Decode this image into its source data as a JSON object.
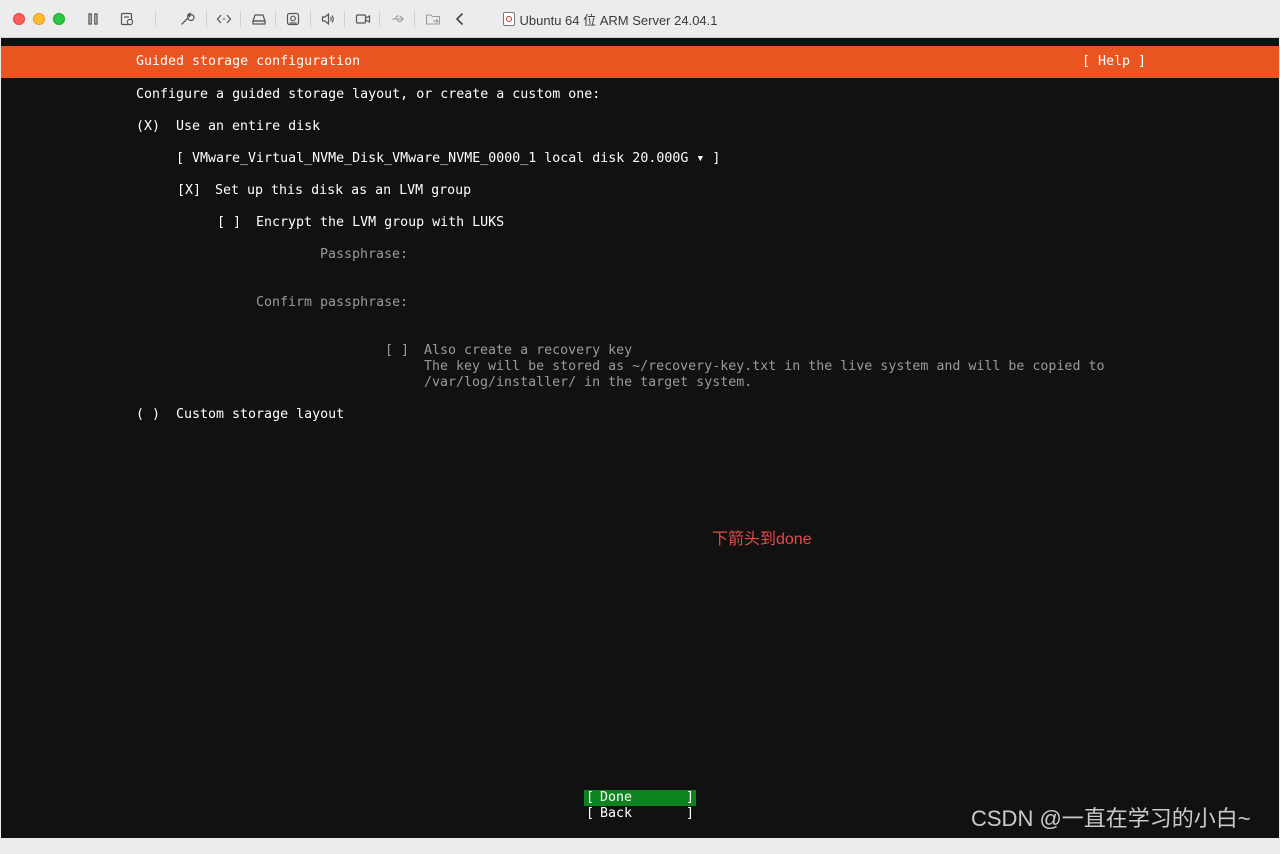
{
  "window": {
    "title": "Ubuntu 64 位 ARM Server 24.04.1",
    "toolbar_icons": [
      "pause-icon",
      "snapshot-icon",
      "wrench-icon",
      "code-icon",
      "disk-icon",
      "camera-icon",
      "sound-icon",
      "video-icon",
      "usb-icon",
      "folder-icon",
      "chevron-left-icon"
    ]
  },
  "installer": {
    "header_title": "Guided storage configuration",
    "help_label": "[ Help ]",
    "intro": "Configure a guided storage layout, or create a custom one:",
    "entire_disk_radio": "(X)",
    "entire_disk_label": "Use an entire disk",
    "disk_select": "[ VMware_Virtual_NVMe_Disk_VMware_NVME_0000_1 local disk 20.000G ▾ ]",
    "lvm_checkbox": "[X]",
    "lvm_label": "Set up this disk as an LVM group",
    "encrypt_checkbox": "[ ]",
    "encrypt_label": "Encrypt the LVM group with LUKS",
    "passphrase_label": "Passphrase:",
    "confirm_label": "Confirm passphrase:",
    "recovery_checkbox": "[ ]",
    "recovery_label": "Also create a recovery key",
    "recovery_desc_1": "The key will be stored as ~/recovery-key.txt in the live system and will be copied to",
    "recovery_desc_2": "/var/log/installer/ in the target system.",
    "custom_radio": "( )",
    "custom_label": "Custom storage layout",
    "done_label": "Done",
    "back_label": "Back"
  },
  "annotation": "下箭头到done",
  "watermark": "CSDN @一直在学习的小白~",
  "colors": {
    "ubuntu_orange": "#e95420",
    "done_green": "#0e8420",
    "annotation_red": "#e84848",
    "console_bg": "#111111"
  }
}
